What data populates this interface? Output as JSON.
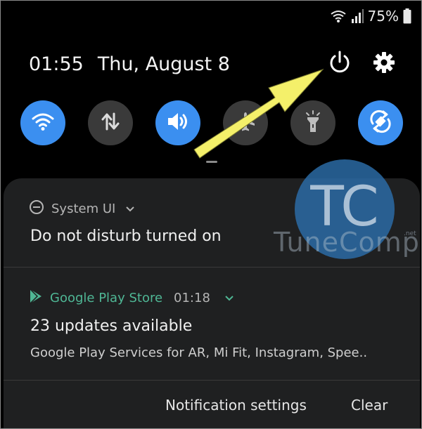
{
  "status_bar": {
    "battery_percent": "75%",
    "icons": [
      "wifi-icon",
      "signal-icon",
      "battery-icon"
    ]
  },
  "quick_panel": {
    "time": "01:55",
    "date": "Thu, August 8",
    "header_icons": [
      "power-icon",
      "gear-icon"
    ],
    "toggles": [
      {
        "name": "wifi",
        "state": "on",
        "icon": "wifi-icon"
      },
      {
        "name": "mobile-data",
        "state": "off",
        "icon": "data-arrows-icon"
      },
      {
        "name": "sound",
        "state": "on",
        "icon": "speaker-icon"
      },
      {
        "name": "airplane-mode",
        "state": "off",
        "icon": "airplane-icon"
      },
      {
        "name": "flashlight",
        "state": "off",
        "icon": "flashlight-icon"
      },
      {
        "name": "auto-rotate",
        "state": "on",
        "icon": "rotate-icon"
      }
    ],
    "accent_color": "#3b8ff0"
  },
  "notifications": [
    {
      "app": "System UI",
      "title": "Do not disturb turned on"
    },
    {
      "app": "Google Play Store",
      "time": "01:18",
      "title": "23 updates available",
      "text": "Google Play Services for AR, Mi Fit, Instagram, Spee.."
    }
  ],
  "actions": {
    "settings_label": "Notification settings",
    "clear_label": "Clear"
  },
  "watermark": {
    "logo_text": "TC",
    "brand": "TuneComp",
    "net": ".net"
  }
}
